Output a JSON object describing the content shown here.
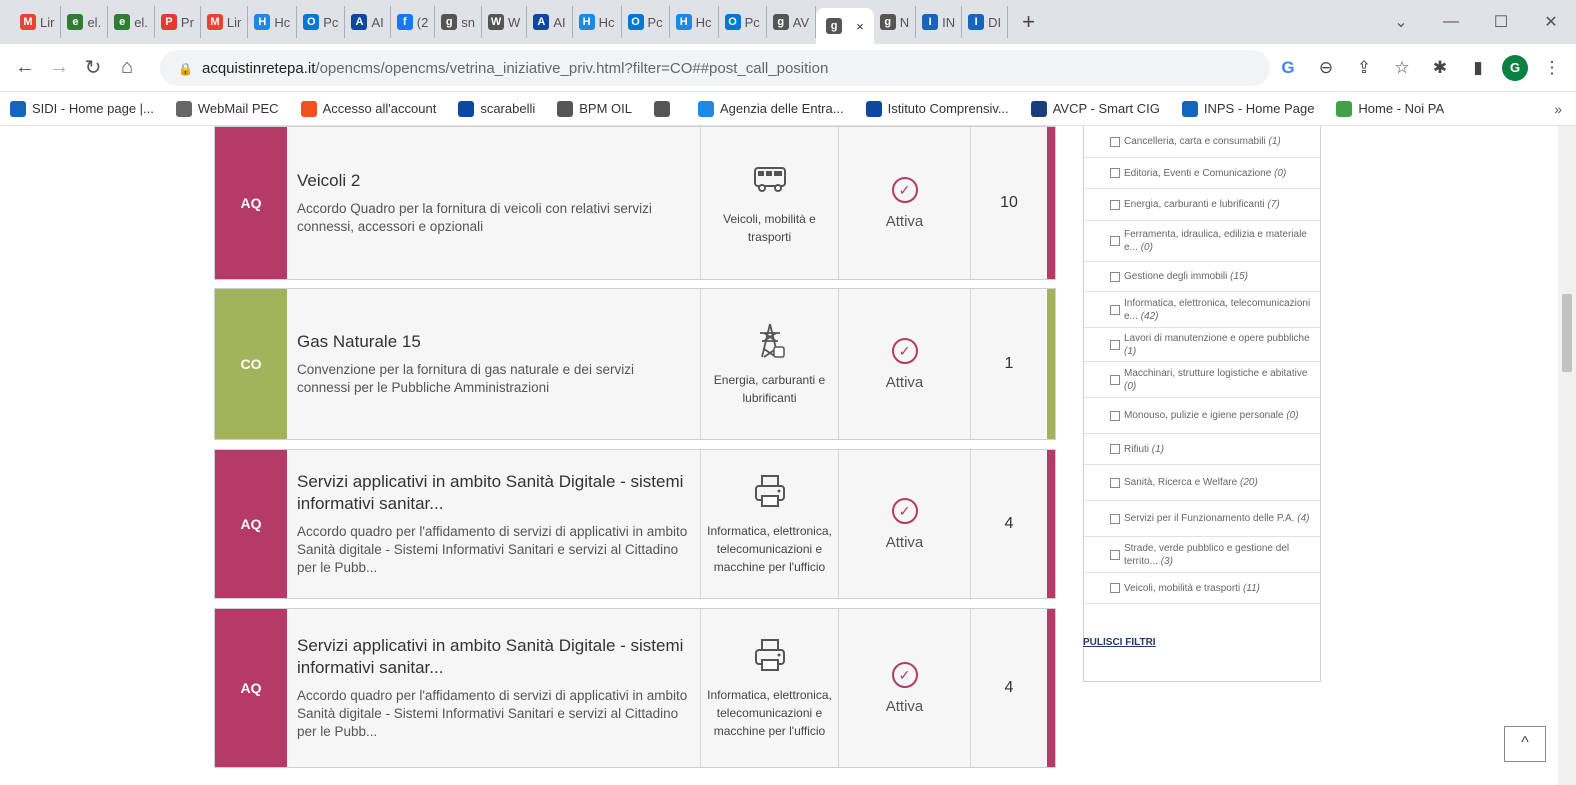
{
  "browser": {
    "tabs": [
      {
        "label": "Lir",
        "icon": "gmail-icon",
        "color": "#ea4335",
        "glyph": "M"
      },
      {
        "label": "el.",
        "icon": "school-icon",
        "color": "#2e7d32",
        "glyph": "e"
      },
      {
        "label": "el.",
        "icon": "school-icon",
        "color": "#2e7d32",
        "glyph": "e"
      },
      {
        "label": "Pr",
        "icon": "portal-icon",
        "color": "#e53935",
        "glyph": "P"
      },
      {
        "label": "Lir",
        "icon": "gmail-icon",
        "color": "#ea4335",
        "glyph": "M"
      },
      {
        "label": "Hc",
        "icon": "chrome-icon",
        "color": "#1e88e5",
        "glyph": "H"
      },
      {
        "label": "Pc",
        "icon": "outlook-icon",
        "color": "#0078d4",
        "glyph": "O"
      },
      {
        "label": "AI",
        "icon": "school-icon",
        "color": "#0d47a1",
        "glyph": "A"
      },
      {
        "label": "(2",
        "icon": "facebook-icon",
        "color": "#1877f2",
        "glyph": "f"
      },
      {
        "label": "sn",
        "icon": "globe-icon",
        "color": "#555555",
        "glyph": "g"
      },
      {
        "label": "W",
        "icon": "webmail-icon",
        "color": "#555555",
        "glyph": "W"
      },
      {
        "label": "AI",
        "icon": "school-icon",
        "color": "#0d47a1",
        "glyph": "A"
      },
      {
        "label": "Hc",
        "icon": "chrome-icon",
        "color": "#1e88e5",
        "glyph": "H"
      },
      {
        "label": "Pc",
        "icon": "outlook-icon",
        "color": "#0078d4",
        "glyph": "O"
      },
      {
        "label": "Hc",
        "icon": "chrome-icon",
        "color": "#1e88e5",
        "glyph": "H"
      },
      {
        "label": "Pc",
        "icon": "outlook-icon",
        "color": "#0078d4",
        "glyph": "O"
      },
      {
        "label": "AV",
        "icon": "globe-icon",
        "color": "#555555",
        "glyph": "g"
      }
    ],
    "tabs_after": [
      {
        "label": "N",
        "icon": "globe-icon",
        "color": "#555555",
        "glyph": "g"
      },
      {
        "label": "IN",
        "icon": "inps-icon",
        "color": "#1565c0",
        "glyph": "I"
      },
      {
        "label": "DI",
        "icon": "inps-icon",
        "color": "#1565c0",
        "glyph": "I"
      }
    ],
    "active_tab_close": "×",
    "new_tab": "+",
    "url_host": "acquistinretepa.it",
    "url_path": "/opencms/opencms/vetrina_iniziative_priv.html?filter=CO##post_call_position",
    "profile_letter": "G",
    "bookmarks": [
      {
        "label": "SIDI - Home page |...",
        "icon": "sidi-icon",
        "color": "#1565c0"
      },
      {
        "label": "WebMail PEC",
        "icon": "webmail-icon",
        "color": "#666666"
      },
      {
        "label": "Accesso all'account",
        "icon": "microsoft-icon",
        "color": "#f25022"
      },
      {
        "label": "scarabelli",
        "icon": "school-icon",
        "color": "#0d47a1"
      },
      {
        "label": "BPM OIL",
        "icon": "globe-icon",
        "color": "#555555"
      },
      {
        "label": "",
        "icon": "globe-icon",
        "color": "#555555"
      },
      {
        "label": "Agenzia delle Entra...",
        "icon": "agenzia-icon",
        "color": "#1e88e5"
      },
      {
        "label": "Istituto Comprensiv...",
        "icon": "school-icon",
        "color": "#0d47a1"
      },
      {
        "label": "AVCP - Smart CIG",
        "icon": "avcp-icon",
        "color": "#1a3d7c"
      },
      {
        "label": "INPS - Home Page",
        "icon": "inps-icon",
        "color": "#1565c0"
      },
      {
        "label": "Home - Noi PA",
        "icon": "noipa-icon",
        "color": "#43a047"
      }
    ],
    "bookmarks_more": "»"
  },
  "initiatives": [
    {
      "badge": "AQ",
      "badge_type": "aq",
      "title": "Veicoli 2",
      "description": "Accordo Quadro per la fornitura di veicoli con relativi servizi connessi, accessori e opzionali",
      "category": "Veicoli, mobilità e trasporti",
      "category_icon": "bus-icon",
      "status": "Attiva",
      "count": "10"
    },
    {
      "badge": "CO",
      "badge_type": "co",
      "title": "Gas Naturale 15",
      "description": "Convenzione per la fornitura di gas naturale e dei servizi connessi per le Pubbliche Amministrazioni",
      "category": "Energia, carburanti e lubrificanti",
      "category_icon": "power-tower-icon",
      "status": "Attiva",
      "count": "1"
    },
    {
      "badge": "AQ",
      "badge_type": "aq",
      "title": "Servizi applicativi in ambito Sanità Digitale - sistemi informativi sanitar...",
      "description": "Accordo quadro per l'affidamento di servizi di applicativi in ambito Sanità digitale - Sistemi Informativi Sanitari e servizi al Cittadino per le Pubb...",
      "category": "Informatica, elettronica, telecomunicazioni e macchine per l'ufficio",
      "category_icon": "printer-icon",
      "status": "Attiva",
      "count": "4"
    },
    {
      "badge": "AQ",
      "badge_type": "aq",
      "title": "Servizi applicativi in ambito Sanità Digitale - sistemi informativi sanitar...",
      "description": "Accordo quadro per l'affidamento di servizi di applicativi in ambito Sanità digitale - Sistemi Informativi Sanitari e servizi al Cittadino per le Pubb...",
      "category": "Informatica, elettronica, telecomunicazioni e macchine per l'ufficio",
      "category_icon": "printer-icon",
      "status": "Attiva",
      "count": "4"
    }
  ],
  "filters": [
    {
      "label": "Cancelleria, carta e consumabili",
      "count": "(1)"
    },
    {
      "label": "Editoria, Eventi e Comunicazione",
      "count": "(0)"
    },
    {
      "label": "Energia, carburanti e lubrificanti",
      "count": "(7)"
    },
    {
      "label": "Ferramenta, idraulica, edilizia e materiale e...",
      "count": "(0)"
    },
    {
      "label": "Gestione degli immobili",
      "count": "(15)"
    },
    {
      "label": "Informatica, elettronica, telecomunicazioni e...",
      "count": "(42)"
    },
    {
      "label": "Lavori di manutenzione e opere pubbliche",
      "count": "(1)"
    },
    {
      "label": "Macchinari, strutture logistiche e abitative",
      "count": "(0)"
    },
    {
      "label": "Monouso, pulizie e igiene personale",
      "count": "(0)"
    },
    {
      "label": "Rifiuti",
      "count": "(1)"
    },
    {
      "label": "Sanità, Ricerca e Welfare",
      "count": "(20)"
    },
    {
      "label": "Servizi per il Funzionamento delle P.A.",
      "count": "(4)"
    },
    {
      "label": "Strade, verde pubblico e gestione del territo...",
      "count": "(3)"
    },
    {
      "label": "Veicoli, mobilità e trasporti",
      "count": "(11)"
    }
  ],
  "clear_filters": "PULISCI FILTRI",
  "back_to_top": "^",
  "colors": {
    "aq": "#b53a66",
    "co": "#a3b35b"
  }
}
